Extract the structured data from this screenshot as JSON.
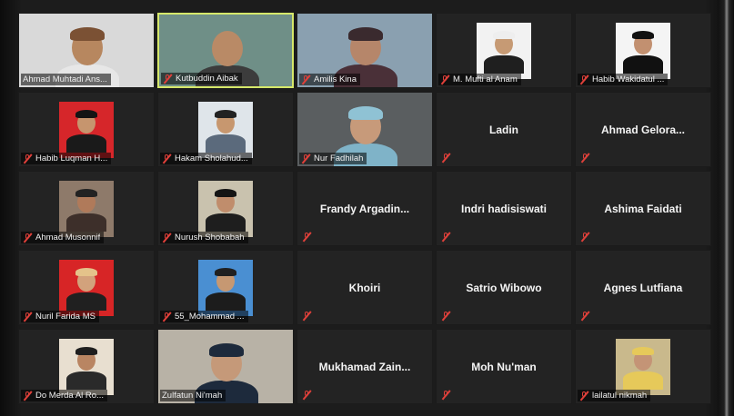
{
  "participants": [
    {
      "name": "Ahmad Muhtadi Ans...",
      "type": "video",
      "muted": false,
      "bg": "#d9d9d9",
      "skin": "#b7875f",
      "shirt": "#e7e7e7",
      "hat": "#7b5134"
    },
    {
      "name": "Kutbuddin Aibak",
      "type": "video",
      "muted": true,
      "active": true,
      "bg": "#6f8f87",
      "skin": "#b98a66",
      "shirt": "#3c3c3c",
      "hat": ""
    },
    {
      "name": "Amilis Kina",
      "type": "video",
      "muted": true,
      "bg": "#8aa0b0",
      "skin": "#b6866a",
      "shirt": "#4a3038",
      "hat": "#3a2a2e"
    },
    {
      "name": "M. Mufti al Anam",
      "type": "photo",
      "muted": true,
      "bg": "#f2f2f2",
      "skin": "#c69a74",
      "shirt": "#1f1f1f",
      "hat": "#eeeeee"
    },
    {
      "name": "Habib Wakidatul ...",
      "type": "photo",
      "muted": true,
      "bg": "#f4f4f4",
      "skin": "#c29070",
      "shirt": "#111111",
      "hat": "#111111"
    },
    {
      "name": "Habib Luqman H...",
      "type": "photo",
      "muted": true,
      "bg": "#d6262a",
      "skin": "#c6956e",
      "shirt": "#1a1a1a",
      "hat": "#141414"
    },
    {
      "name": "Hakam Sholahud...",
      "type": "photo",
      "muted": true,
      "bg": "#dfe5ea",
      "skin": "#c7976f",
      "shirt": "#5b6a7c",
      "hat": "#222222"
    },
    {
      "name": "Nur Fadhilah",
      "type": "video",
      "muted": true,
      "bg": "#5a5e60",
      "skin": "#c79a7a",
      "shirt": "#7fb3c8",
      "hat": "#8fc2d4"
    },
    {
      "name": "Ladin",
      "type": "text",
      "muted": true
    },
    {
      "name": "Ahmad  Gelora...",
      "type": "text",
      "muted": true
    },
    {
      "name": "Ahmad Musonnif",
      "type": "photo",
      "muted": true,
      "bg": "#8e7a6a",
      "skin": "#b07a5a",
      "shirt": "#3d2f2a",
      "hat": "#222222"
    },
    {
      "name": "Nurush Shobabah",
      "type": "photo",
      "muted": true,
      "bg": "#c9c2ae",
      "skin": "#c08d6c",
      "shirt": "#1e1e1e",
      "hat": "#141414"
    },
    {
      "name": "Frandy  Argadin...",
      "type": "text",
      "muted": true
    },
    {
      "name": "Indri hadisiswati",
      "type": "text",
      "muted": true
    },
    {
      "name": "Ashima Faidati",
      "type": "text",
      "muted": true
    },
    {
      "name": "Nuril Farida MS",
      "type": "photo",
      "muted": true,
      "bg": "#d72526",
      "skin": "#d2a27c",
      "shirt": "#202020",
      "hat": "#e4c38a"
    },
    {
      "name": "55_Mohammad ...",
      "type": "photo",
      "muted": true,
      "bg": "#4a8fd2",
      "skin": "#c69872",
      "shirt": "#1c1c1c",
      "hat": "#202020"
    },
    {
      "name": "Khoiri",
      "type": "text",
      "muted": true
    },
    {
      "name": "Satrio Wibowo",
      "type": "text",
      "muted": true
    },
    {
      "name": "Agnes Lutfiana",
      "type": "text",
      "muted": true
    },
    {
      "name": "Do Merda Al Ro...",
      "type": "photo",
      "muted": true,
      "bg": "#e8dfd0",
      "skin": "#b98562",
      "shirt": "#2a2a2a",
      "hat": "#1e1e1e"
    },
    {
      "name": "Zulfatun Ni'mah",
      "type": "video",
      "muted": false,
      "bg": "#b8b2a6",
      "skin": "#c59979",
      "shirt": "#1d2a3c",
      "hat": "#1d2a3c"
    },
    {
      "name": "Mukhamad  Zain...",
      "type": "text",
      "muted": true
    },
    {
      "name": "Moh Nu'man",
      "type": "text",
      "muted": true
    },
    {
      "name": "lailatul nikmah",
      "type": "photo",
      "muted": true,
      "bg": "#c9b98c",
      "skin": "#c49476",
      "shirt": "#e6c95a",
      "hat": "#e6c95a"
    }
  ]
}
